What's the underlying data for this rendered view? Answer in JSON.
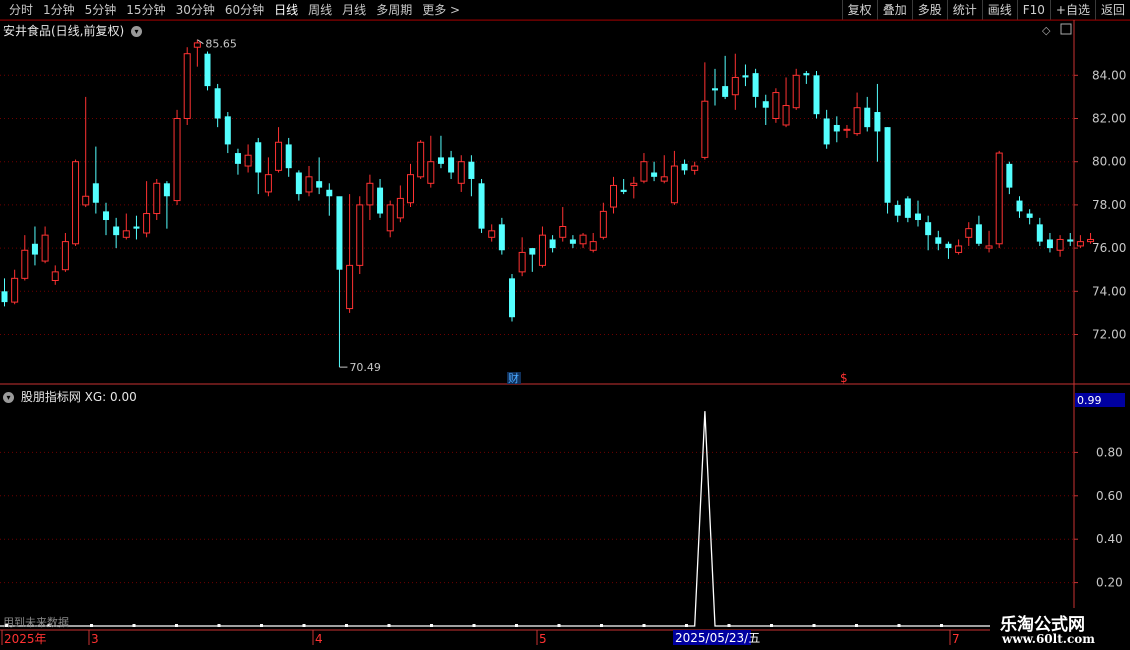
{
  "toolbar": {
    "tabs": [
      "分时",
      "1分钟",
      "5分钟",
      "15分钟",
      "30分钟",
      "60分钟",
      "日线",
      "周线",
      "月线",
      "多周期",
      "更多 >"
    ],
    "active_tab": "日线",
    "tools": [
      "复权",
      "叠加",
      "多股",
      "统计",
      "画线",
      "F10",
      "+自选",
      "返回"
    ]
  },
  "main_panel": {
    "title": "安井食品(日线,前复权)",
    "y_ticks": [
      "84.00",
      "82.00",
      "80.00",
      "78.00",
      "76.00",
      "74.00",
      "72.00"
    ],
    "high_label": "85.65",
    "low_label": "70.49",
    "marker_cai": "财",
    "marker_dollar": "$"
  },
  "indicator_panel": {
    "title": "股朋指标网 XG: 0.00",
    "y_ticks": [
      "0.80",
      "0.60",
      "0.40",
      "0.20"
    ],
    "current_value": "0.99"
  },
  "date_axis": {
    "labels": [
      "2025年",
      "3",
      "4",
      "5",
      "7"
    ],
    "highlight": "2025/05/23/五"
  },
  "future_note": "用到未来数据",
  "watermark": {
    "line1": "乐淘公式网",
    "line2": "www.60lt.com"
  },
  "chart_data": [
    {
      "type": "candlestick",
      "title": "安井食品(日线,前复权)",
      "y_range": [
        71,
        86
      ],
      "annotations": {
        "high": 85.65,
        "low": 70.49
      },
      "candles": [
        [
          74.0,
          73.5,
          74.6,
          73.3
        ],
        [
          73.5,
          74.6,
          75.0,
          73.4
        ],
        [
          74.6,
          75.9,
          76.6,
          74.5
        ],
        [
          76.2,
          75.7,
          77.0,
          75.2
        ],
        [
          75.4,
          76.6,
          77.0,
          75.3
        ],
        [
          74.5,
          74.9,
          75.2,
          74.3
        ],
        [
          75.0,
          76.3,
          76.7,
          74.9
        ],
        [
          76.2,
          80.0,
          80.1,
          76.1
        ],
        [
          78.0,
          78.4,
          83.0,
          77.9
        ],
        [
          79.0,
          78.1,
          80.7,
          77.6
        ],
        [
          77.7,
          77.3,
          78.1,
          76.6
        ],
        [
          77.0,
          76.6,
          77.4,
          76.0
        ],
        [
          76.5,
          76.8,
          77.6,
          76.4
        ],
        [
          77.0,
          76.9,
          77.5,
          76.4
        ],
        [
          76.7,
          77.6,
          79.1,
          76.5
        ],
        [
          77.6,
          79.0,
          79.2,
          77.3
        ],
        [
          79.0,
          78.4,
          79.1,
          76.9
        ],
        [
          78.2,
          82.0,
          82.4,
          78.0
        ],
        [
          82.0,
          85.0,
          85.3,
          81.7
        ],
        [
          85.3,
          85.5,
          85.65,
          84.4
        ],
        [
          85.0,
          83.5,
          85.1,
          83.3
        ],
        [
          83.4,
          82.0,
          83.6,
          81.6
        ],
        [
          82.1,
          80.8,
          82.3,
          80.4
        ],
        [
          80.4,
          79.9,
          80.6,
          79.4
        ],
        [
          79.8,
          80.3,
          80.8,
          79.5
        ],
        [
          80.9,
          79.5,
          81.1,
          78.5
        ],
        [
          78.6,
          79.4,
          80.2,
          78.4
        ],
        [
          79.6,
          80.9,
          81.6,
          79.5
        ],
        [
          80.8,
          79.7,
          81.1,
          79.3
        ],
        [
          79.5,
          78.5,
          79.6,
          78.2
        ],
        [
          78.6,
          79.3,
          79.8,
          78.4
        ],
        [
          79.1,
          78.8,
          80.2,
          78.5
        ],
        [
          78.7,
          78.4,
          79.0,
          77.5
        ],
        [
          78.4,
          75.0,
          76.9,
          70.49
        ],
        [
          73.2,
          75.2,
          78.5,
          73.0
        ],
        [
          75.2,
          78.0,
          78.4,
          74.8
        ],
        [
          78.0,
          79.0,
          79.4,
          77.3
        ],
        [
          78.8,
          77.6,
          79.2,
          77.4
        ],
        [
          76.8,
          78.0,
          78.2,
          76.5
        ],
        [
          77.4,
          78.3,
          78.9,
          77.2
        ],
        [
          78.1,
          79.4,
          79.9,
          77.9
        ],
        [
          79.3,
          80.9,
          81.0,
          79.2
        ],
        [
          79.0,
          80.0,
          81.2,
          78.8
        ],
        [
          80.2,
          79.9,
          81.2,
          79.7
        ],
        [
          80.2,
          79.5,
          80.5,
          79.2
        ],
        [
          79.0,
          80.0,
          80.3,
          78.6
        ],
        [
          80.0,
          79.2,
          80.3,
          78.4
        ],
        [
          79.0,
          76.9,
          79.2,
          76.7
        ],
        [
          76.5,
          76.8,
          77.1,
          76.3
        ],
        [
          77.1,
          75.9,
          77.4,
          75.7
        ],
        [
          74.6,
          72.8,
          74.8,
          72.6
        ],
        [
          74.9,
          75.8,
          76.5,
          74.7
        ],
        [
          76.0,
          75.7,
          76.0,
          74.9
        ],
        [
          75.2,
          76.6,
          77.0,
          75.1
        ],
        [
          76.4,
          76.0,
          76.6,
          75.8
        ],
        [
          76.5,
          77.0,
          77.9,
          76.3
        ],
        [
          76.4,
          76.2,
          76.6,
          76.0
        ],
        [
          76.2,
          76.6,
          76.7,
          76.0
        ],
        [
          75.9,
          76.3,
          76.7,
          75.8
        ],
        [
          76.5,
          77.7,
          78.1,
          76.4
        ],
        [
          77.9,
          78.9,
          79.3,
          77.6
        ],
        [
          78.7,
          78.6,
          79.2,
          78.5
        ],
        [
          78.9,
          79.0,
          79.3,
          78.3
        ],
        [
          79.1,
          80.0,
          80.4,
          79.0
        ],
        [
          79.5,
          79.3,
          80.0,
          79.1
        ],
        [
          79.1,
          79.3,
          80.3,
          79.0
        ],
        [
          78.1,
          79.8,
          80.5,
          78.0
        ],
        [
          79.9,
          79.6,
          80.1,
          79.4
        ],
        [
          79.6,
          79.8,
          80.0,
          79.4
        ],
        [
          80.2,
          82.8,
          84.6,
          80.1
        ],
        [
          83.4,
          83.3,
          84.3,
          82.6
        ],
        [
          83.5,
          83.0,
          84.9,
          82.9
        ],
        [
          83.1,
          83.9,
          85.0,
          82.4
        ],
        [
          84.0,
          83.9,
          84.5,
          83.5
        ],
        [
          84.1,
          83.0,
          84.3,
          82.5
        ],
        [
          82.8,
          82.5,
          83.1,
          81.7
        ],
        [
          82.0,
          83.2,
          83.4,
          81.8
        ],
        [
          81.7,
          82.6,
          83.9,
          81.6
        ],
        [
          82.5,
          84.0,
          84.3,
          82.4
        ],
        [
          84.1,
          84.0,
          84.2,
          83.6
        ],
        [
          84.0,
          82.2,
          84.2,
          82.0
        ],
        [
          82.0,
          80.8,
          82.4,
          80.6
        ],
        [
          81.7,
          81.4,
          82.1,
          80.9
        ],
        [
          81.5,
          81.5,
          81.7,
          81.1
        ],
        [
          81.3,
          82.5,
          83.2,
          81.2
        ],
        [
          82.5,
          81.6,
          83.0,
          81.4
        ],
        [
          82.3,
          81.4,
          83.6,
          80.0
        ],
        [
          81.6,
          78.1,
          81.6,
          77.6
        ],
        [
          78.0,
          77.5,
          78.2,
          77.2
        ],
        [
          78.3,
          77.4,
          78.4,
          77.2
        ],
        [
          77.6,
          77.3,
          78.2,
          77.0
        ],
        [
          77.2,
          76.6,
          77.5,
          75.9
        ],
        [
          76.5,
          76.2,
          76.8,
          75.9
        ],
        [
          76.2,
          76.0,
          76.3,
          75.5
        ],
        [
          75.8,
          76.1,
          76.4,
          75.7
        ],
        [
          76.5,
          76.9,
          77.2,
          76.1
        ],
        [
          77.1,
          76.2,
          77.5,
          76.1
        ],
        [
          76.0,
          76.1,
          76.8,
          75.8
        ],
        [
          76.2,
          80.4,
          80.5,
          76.0
        ],
        [
          79.9,
          78.8,
          80.0,
          78.5
        ],
        [
          78.2,
          77.7,
          78.4,
          77.4
        ],
        [
          77.6,
          77.4,
          77.8,
          77.1
        ],
        [
          77.1,
          76.3,
          77.4,
          76.1
        ],
        [
          76.4,
          76.0,
          76.7,
          75.8
        ],
        [
          75.9,
          76.4,
          76.6,
          75.6
        ],
        [
          76.4,
          76.3,
          76.7,
          76.1
        ],
        [
          76.1,
          76.3,
          76.6,
          76.0
        ],
        [
          76.3,
          76.4,
          76.7,
          76.2
        ]
      ]
    },
    {
      "type": "line",
      "title": "股朋指标网 XG",
      "y_range": [
        0,
        1
      ],
      "series": [
        {
          "name": "XG",
          "spike_bar_index": 69,
          "spike_value": 0.99,
          "baseline": 0
        }
      ]
    }
  ]
}
